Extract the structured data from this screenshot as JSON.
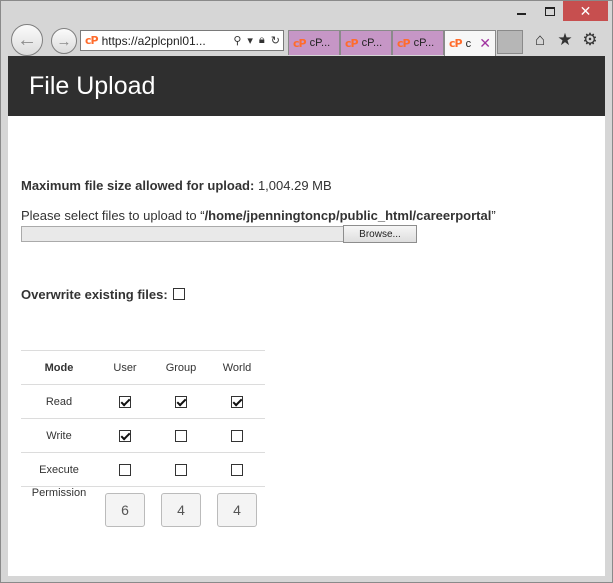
{
  "browser": {
    "address": {
      "url": "https://a2plcpnl01...",
      "logo": "cP"
    },
    "tabs": [
      {
        "label": "cP...",
        "active": false
      },
      {
        "label": "cP...",
        "active": false
      },
      {
        "label": "cP...",
        "active": false
      },
      {
        "label": "c",
        "active": true
      }
    ],
    "colors": {
      "tab_inactive": "#c696c6",
      "close_button": "#c74f4f",
      "logo": "#ff6c2c"
    }
  },
  "page": {
    "title": "File Upload",
    "max_size_label": "Maximum file size allowed for upload:",
    "max_size_value": "1,004.29 MB",
    "select_prefix": "Please select files to upload to “",
    "select_path": "/home/jpenningtoncp/public_html/careerportal",
    "select_suffix": "”",
    "browse_label": "Browse...",
    "overwrite_label": "Overwrite existing files:",
    "overwrite_checked": false
  },
  "permissions": {
    "headers": [
      "Mode",
      "User",
      "Group",
      "World"
    ],
    "rows": [
      {
        "label": "Read",
        "values": [
          true,
          true,
          true
        ]
      },
      {
        "label": "Write",
        "values": [
          true,
          false,
          false
        ]
      },
      {
        "label": "Execute",
        "values": [
          false,
          false,
          false
        ]
      }
    ],
    "permission_label": "Permission",
    "permission_values": [
      "6",
      "4",
      "4"
    ]
  }
}
